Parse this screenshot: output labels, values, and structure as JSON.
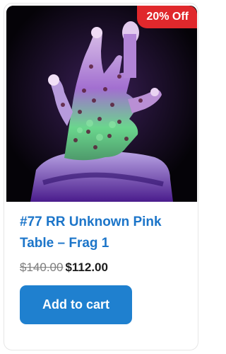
{
  "product": {
    "badge": "20% Off",
    "title": "#77 RR Unknown Pink Table – Frag 1",
    "regular_price": "$140.00",
    "sale_price": "$112.00",
    "add_to_cart_label": "Add to cart",
    "image_icon": "coral-frag-photo"
  },
  "colors": {
    "accent": "#1f80cf",
    "title": "#1c75c9",
    "badge": "#e0282c",
    "price_old": "#7f7f7f",
    "price_new": "#1b1b1b"
  }
}
